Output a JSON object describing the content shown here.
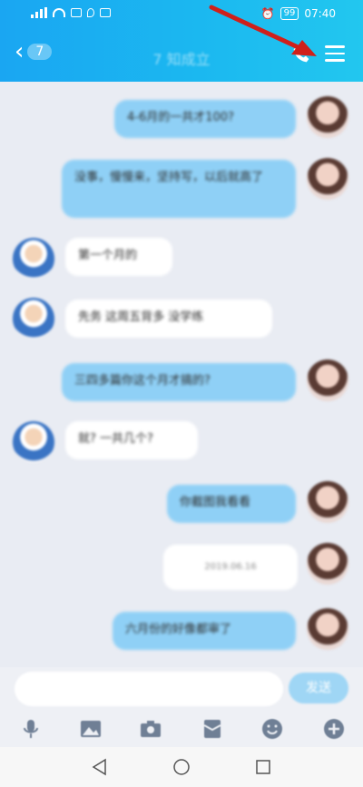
{
  "status": {
    "time": "07:40",
    "battery": "99"
  },
  "nav": {
    "back_count": "7",
    "title": "7 知成立"
  },
  "messages": [
    {
      "side": "me",
      "text": "4-6月的一共才100?"
    },
    {
      "side": "me",
      "text": "没事，慢慢来，坚持写，以后就高了"
    },
    {
      "side": "other",
      "text": "第一个月的"
    },
    {
      "side": "other",
      "text": "先务 这周五背多 没学练"
    },
    {
      "side": "me",
      "text": "三四多篇你这个月才搞的?"
    },
    {
      "side": "other",
      "text": "就? 一共几个?"
    },
    {
      "side": "me",
      "text": "你截图我看看"
    },
    {
      "side": "me",
      "text": "2019.06.16",
      "kind": "date"
    },
    {
      "side": "me",
      "text": "六月份的好像都审了"
    }
  ],
  "input": {
    "send_label": "发送"
  },
  "colors": {
    "header": "#1aa6f2",
    "my_bubble": "#8fd0f6",
    "accent_arrow": "#d0201b"
  }
}
